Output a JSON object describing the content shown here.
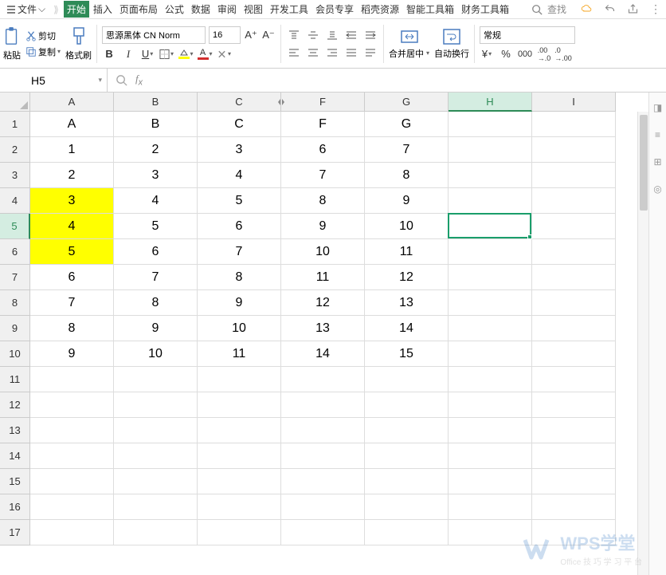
{
  "menu": {
    "file": "文件",
    "tabs": [
      "开始",
      "插入",
      "页面布局",
      "公式",
      "数据",
      "审阅",
      "视图",
      "开发工具",
      "会员专享",
      "稻壳资源",
      "智能工具箱",
      "财务工具箱"
    ],
    "active_tab": 0,
    "search_placeholder": "查找"
  },
  "ribbon": {
    "paste": "粘贴",
    "cut": "剪切",
    "copy": "复制",
    "format_painter": "格式刷",
    "font_name": "思源黑体 CN Norm",
    "font_size": "16",
    "merge_center": "合并居中",
    "wrap_text": "自动换行",
    "num_format": "常规"
  },
  "cellref": "H5",
  "grid": {
    "columns": [
      "A",
      "B",
      "C",
      "F",
      "G",
      "H",
      "I"
    ],
    "active_col_index": 5,
    "active_row_index": 4,
    "row_count": 17,
    "rows": [
      [
        "A",
        "B",
        "C",
        "F",
        "G",
        "",
        ""
      ],
      [
        "1",
        "2",
        "3",
        "6",
        "7",
        "",
        ""
      ],
      [
        "2",
        "3",
        "4",
        "7",
        "8",
        "",
        ""
      ],
      [
        "3",
        "4",
        "5",
        "8",
        "9",
        "",
        ""
      ],
      [
        "4",
        "5",
        "6",
        "9",
        "10",
        "",
        ""
      ],
      [
        "5",
        "6",
        "7",
        "10",
        "11",
        "",
        ""
      ],
      [
        "6",
        "7",
        "8",
        "11",
        "12",
        "",
        ""
      ],
      [
        "7",
        "8",
        "9",
        "12",
        "13",
        "",
        ""
      ],
      [
        "8",
        "9",
        "10",
        "13",
        "14",
        "",
        ""
      ],
      [
        "9",
        "10",
        "11",
        "14",
        "15",
        "",
        ""
      ],
      [
        "",
        "",
        "",
        "",
        "",
        "",
        ""
      ],
      [
        "",
        "",
        "",
        "",
        "",
        "",
        ""
      ],
      [
        "",
        "",
        "",
        "",
        "",
        "",
        ""
      ],
      [
        "",
        "",
        "",
        "",
        "",
        "",
        ""
      ],
      [
        "",
        "",
        "",
        "",
        "",
        "",
        ""
      ],
      [
        "",
        "",
        "",
        "",
        "",
        "",
        ""
      ],
      [
        "",
        "",
        "",
        "",
        "",
        "",
        ""
      ]
    ],
    "yellow_cells": [
      [
        3,
        0
      ],
      [
        4,
        0
      ],
      [
        5,
        0
      ]
    ]
  },
  "watermark": {
    "title": "WPS学堂",
    "sub": "Office 技 巧 学 习 平 台"
  }
}
